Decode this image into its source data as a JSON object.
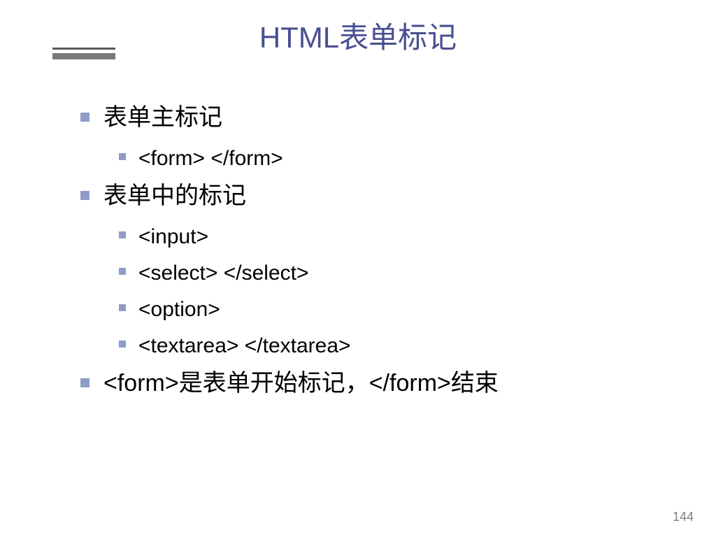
{
  "title": "HTML表单标记",
  "bullets": [
    {
      "level": 1,
      "text": "表单主标记"
    },
    {
      "level": 2,
      "text": "<form> </form>"
    },
    {
      "level": 1,
      "text": "表单中的标记"
    },
    {
      "level": 2,
      "text": "<input>"
    },
    {
      "level": 2,
      "text": "<select> </select>"
    },
    {
      "level": 2,
      "text": "<option>"
    },
    {
      "level": 2,
      "text": "<textarea> </textarea>"
    },
    {
      "level": 1,
      "text": "<form>是表单开始标记，</form>结束"
    }
  ],
  "page_number": "144"
}
